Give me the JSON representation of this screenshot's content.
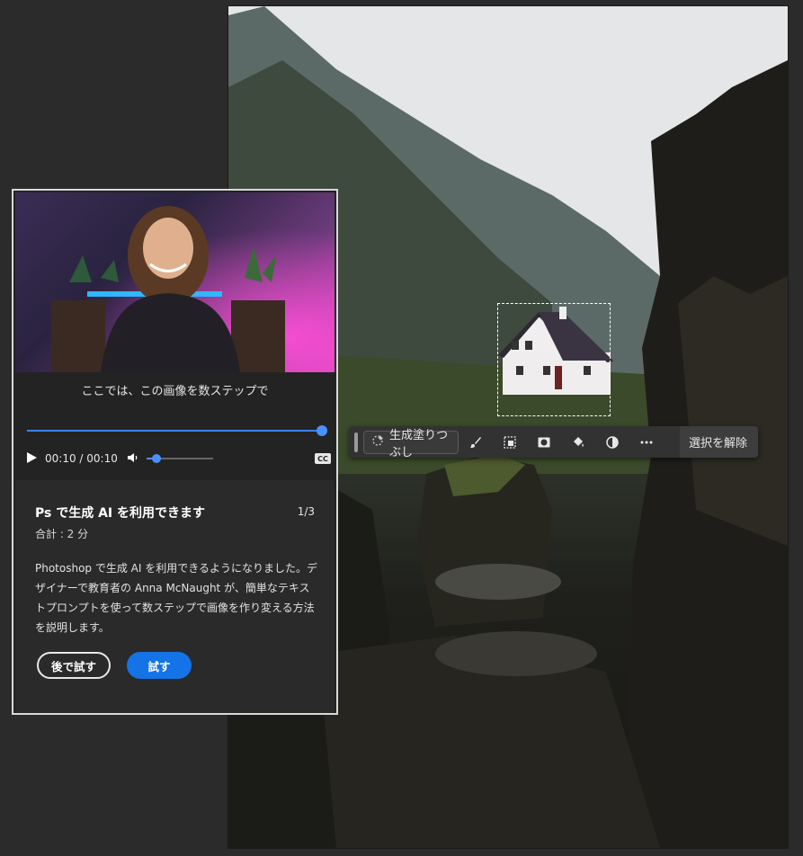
{
  "video": {
    "caption": "ここでは、この画像を数ステップで",
    "time": "00:10 / 00:10",
    "progress": 1.0,
    "volume": 0.1,
    "cc_label": "CC"
  },
  "tutorial": {
    "title": "Ps で生成 AI を利用できます",
    "step": "1/3",
    "duration": "合計 : 2 分",
    "description": "Photoshop で生成 AI を利用できるようになりました。デザイナーで教育者の Anna McNaught が、簡単なテキストプロンプトを使って数ステップで画像を作り変える方法を説明します。",
    "later_button": "後で試す",
    "try_button": "試す"
  },
  "taskbar": {
    "generative_fill": "生成塗りつぶし",
    "deselect": "選択を解除",
    "icons": [
      "brush-icon",
      "transform-selection-icon",
      "mask-icon",
      "fill-bucket-icon",
      "adjustment-icon",
      "more-icon"
    ]
  },
  "colors": {
    "accent": "#1473e6",
    "progress": "#3b82f6",
    "panel_bg": "#232323",
    "app_bg": "#2b2b2b"
  }
}
